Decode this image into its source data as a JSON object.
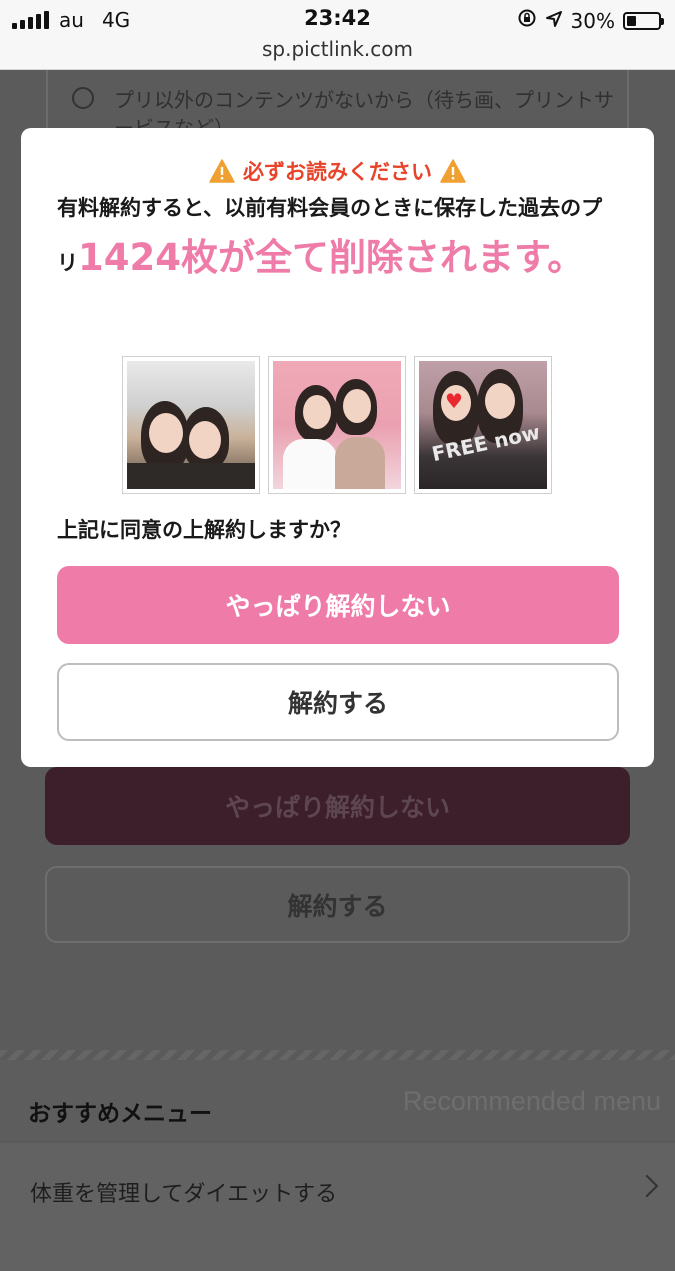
{
  "status_bar": {
    "carrier": "au",
    "network": "4G",
    "time": "23:42",
    "battery_percent": "30%",
    "battery_level": 0.3,
    "url": "sp.pictlink.com"
  },
  "background": {
    "option_text": "プリ以外のコンテンツがないから（待ち画、プリントサービスなど）",
    "keep_button_label": "やっぱり解約しない",
    "cancel_button_label": "解約する",
    "menu_title": "おすすめメニュー",
    "menu_title_en": "Recommended menu",
    "menu_item": "体重を管理してダイエットする"
  },
  "modal": {
    "warning_title": "必ずお読みください",
    "message_before": "有料解約すると、以前有料会員のときに保存した過去のプリ",
    "message_highlight": "1424枚が全て削除されます。",
    "photo_text": "FREE now",
    "question": "上記に同意の上解約しますか？",
    "keep_button_label": "やっぱり解約しない",
    "cancel_button_label": "解約する"
  },
  "colors": {
    "accent_pink": "#ef7ba8",
    "warning_red": "#e8442b",
    "warning_orange": "#f0a030"
  }
}
